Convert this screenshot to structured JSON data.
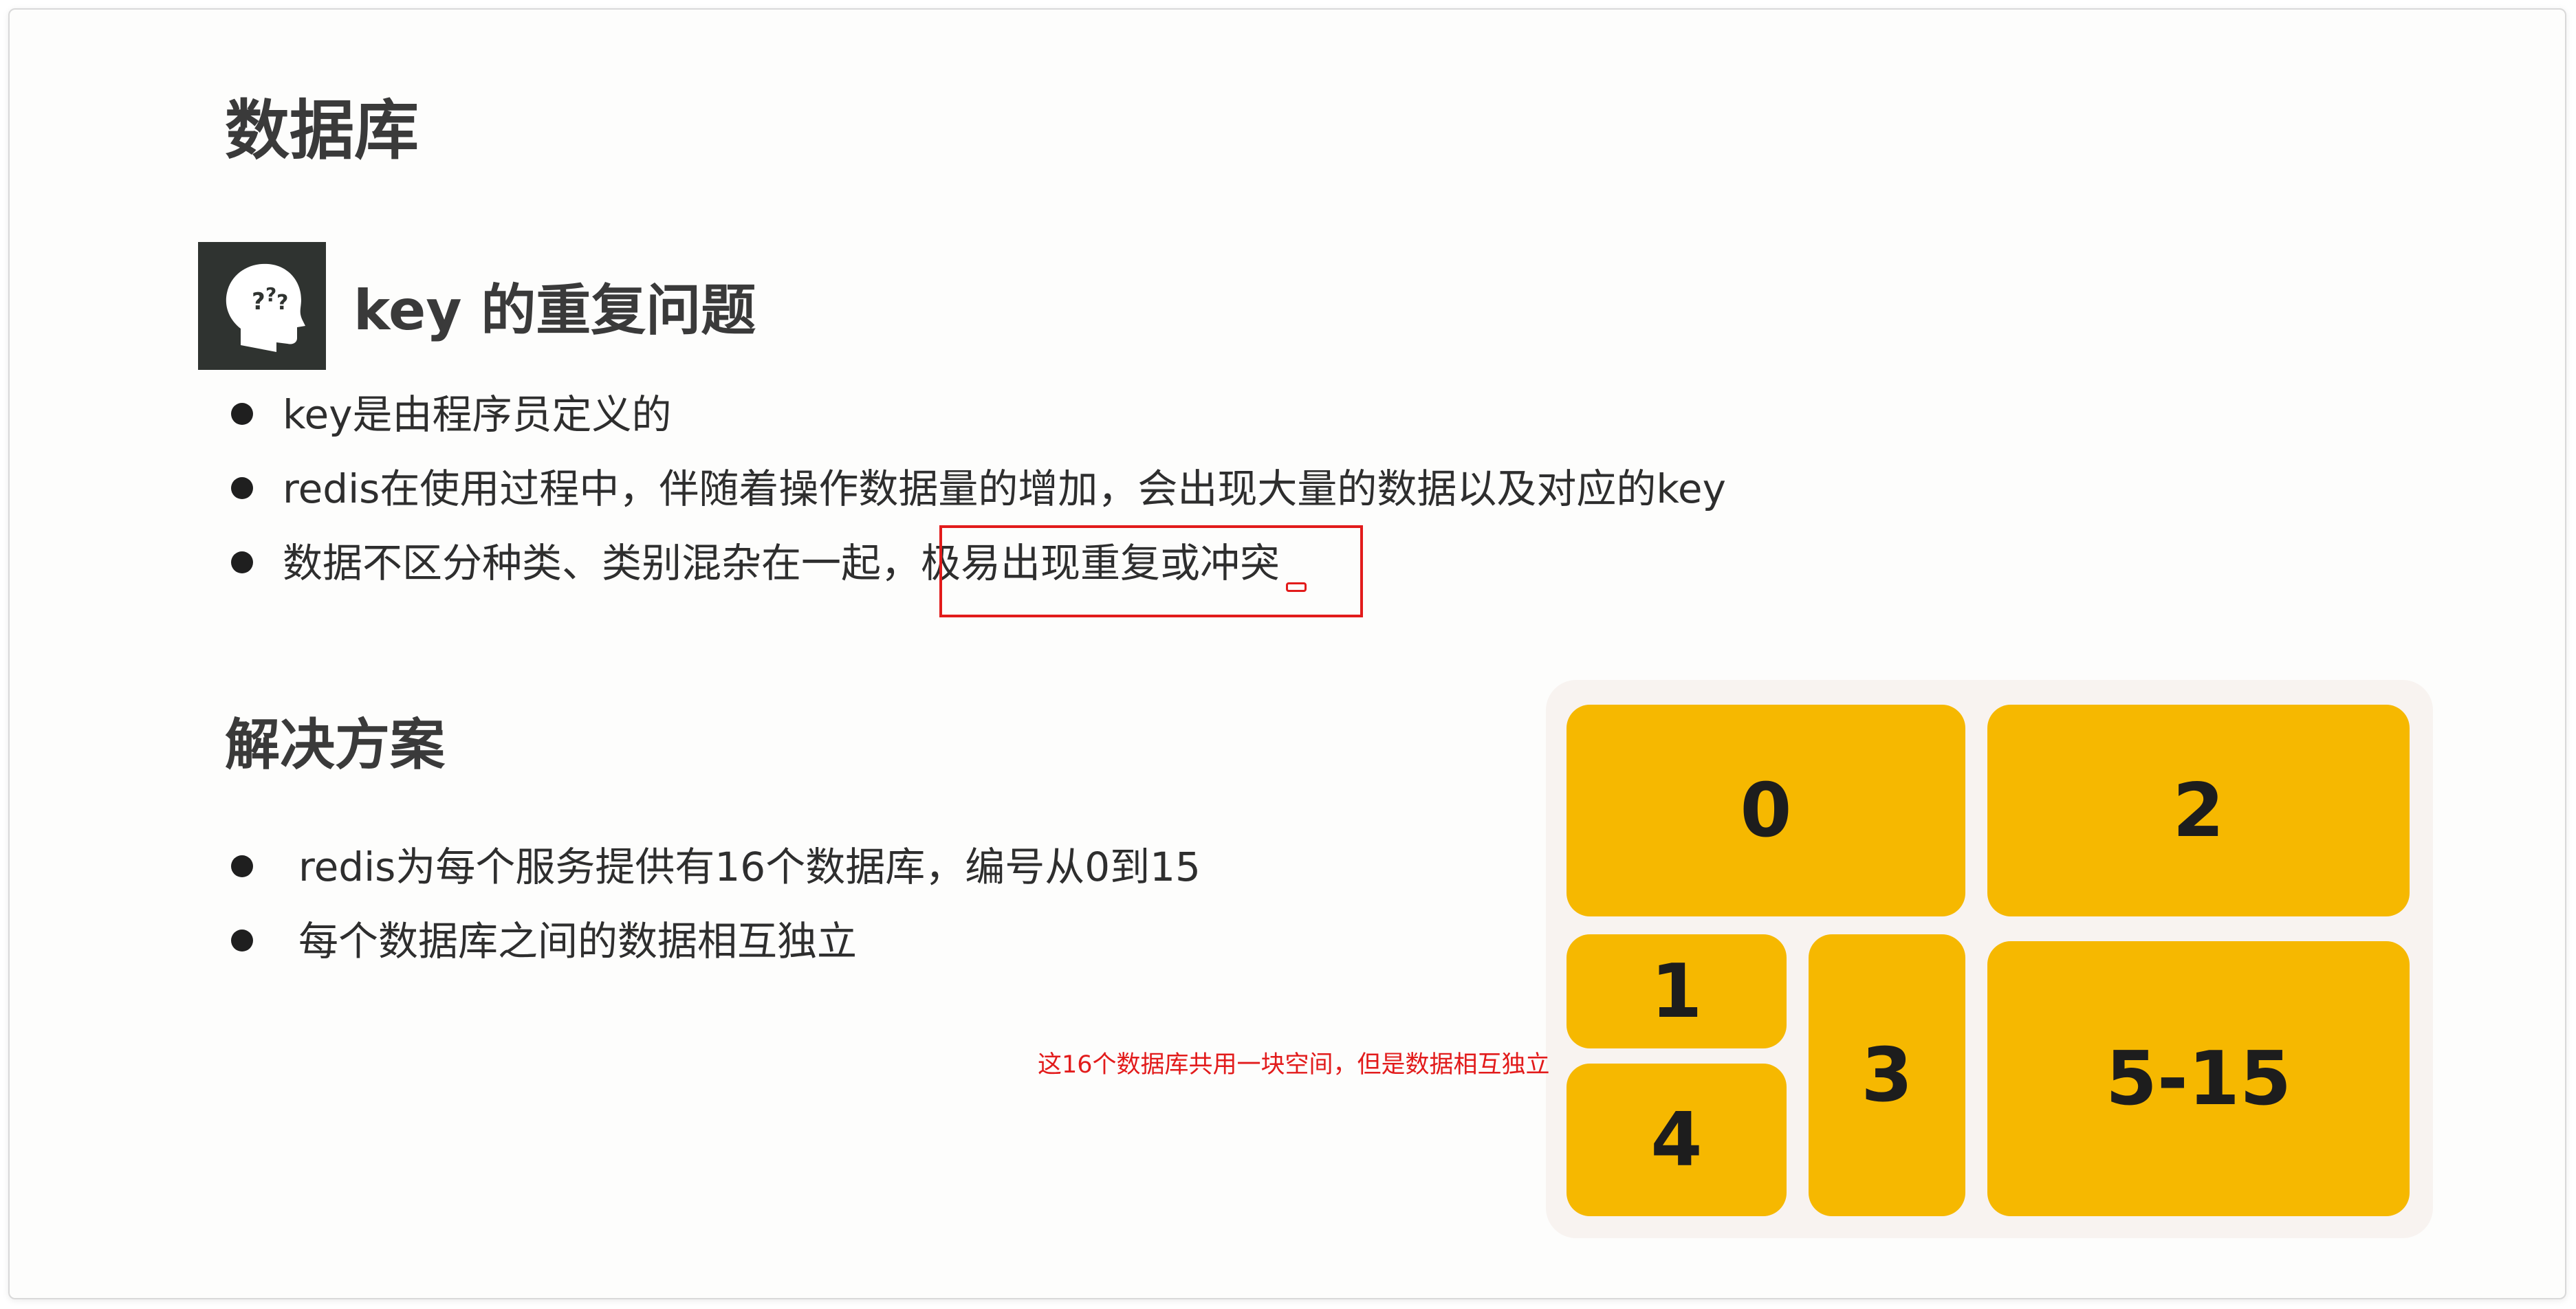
{
  "slide": {
    "title": "数据库",
    "problem_section": {
      "icon": "thinking-head-icon",
      "title": "key 的重复问题",
      "bullets": [
        "key是由程序员定义的",
        "redis在使用过程中，伴随着操作数据量的增加，会出现大量的数据以及对应的key",
        "数据不区分种类、类别混杂在一起，极易出现重复或冲突"
      ]
    },
    "solution_section": {
      "title": "解决方案",
      "bullets": [
        "redis为每个服务提供有16个数据库，编号从0到15",
        "每个数据库之间的数据相互独立"
      ]
    },
    "database_blocks": [
      "0",
      "2",
      "1",
      "3",
      "5-15",
      "4"
    ],
    "annotation": "这16个数据库共用一块空间，但是数据相互独立"
  },
  "colors": {
    "block_fill": "#f6b800",
    "panel_bg": "#f8f3f0",
    "highlight_red": "#e21b1b",
    "text": "#2e2e2e"
  }
}
